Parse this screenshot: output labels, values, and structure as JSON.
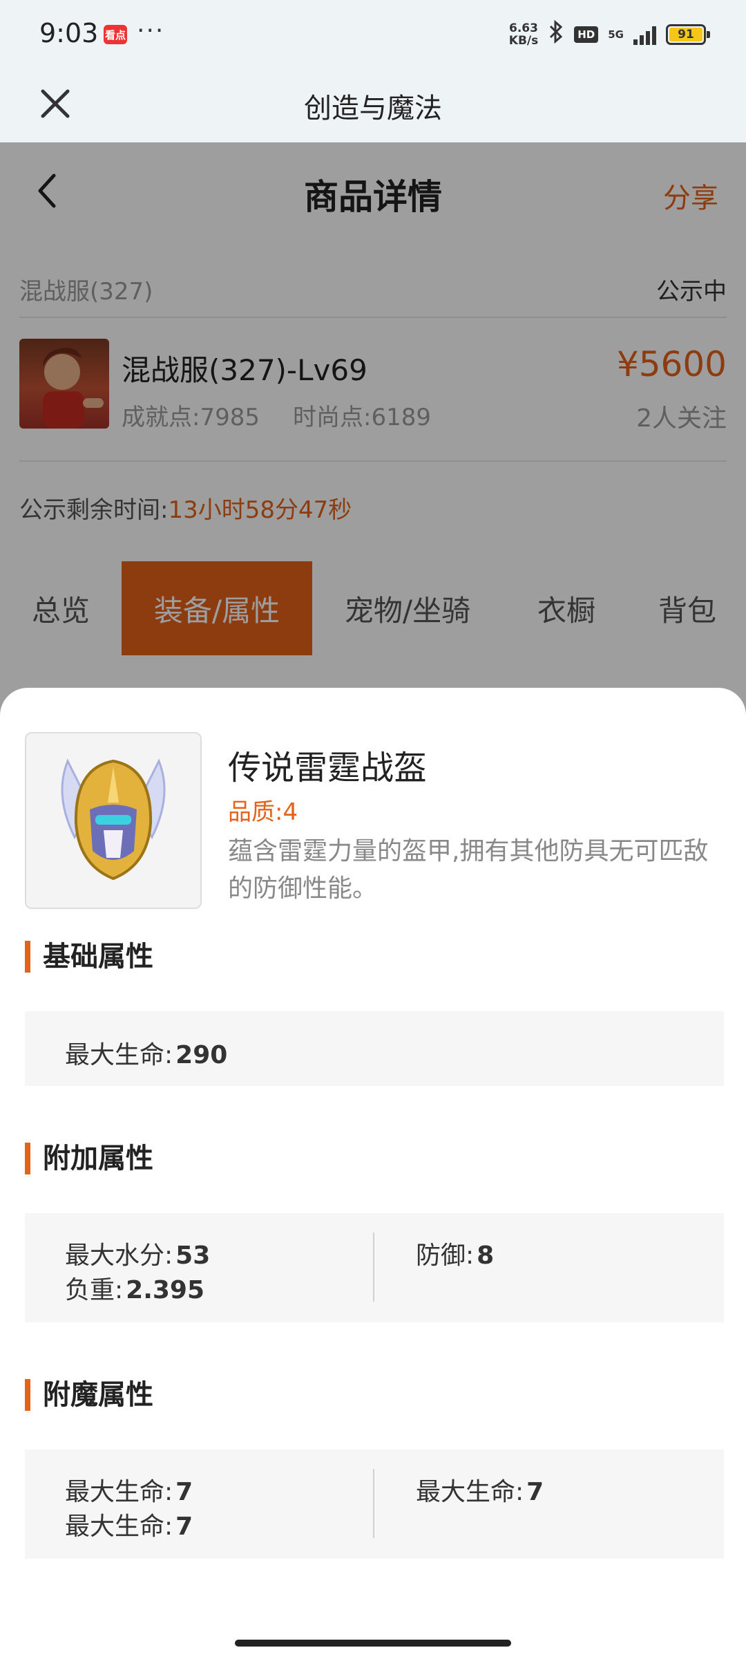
{
  "status": {
    "time": "9:03",
    "app_badge": "看点",
    "more": "···",
    "speed_top": "6.63",
    "speed_unit": "KB/s",
    "hd": "HD",
    "net": "5G",
    "battery": "91"
  },
  "browser": {
    "title": "创造与魔法"
  },
  "nav": {
    "title": "商品详情",
    "share": "分享"
  },
  "info": {
    "server_name": "混战服(327)",
    "status": "公示中"
  },
  "product": {
    "title": "混战服(327)-Lv69",
    "achievement": "成就点:7985",
    "fashion": "时尚点:6189",
    "price": "¥5600",
    "followers": "2人关注"
  },
  "remaining": {
    "label": "公示剩余时间:",
    "value": "13小时58分47秒"
  },
  "tabs": [
    {
      "label": "总览"
    },
    {
      "label": "装备/属性"
    },
    {
      "label": "宠物/坐骑"
    },
    {
      "label": "衣橱"
    },
    {
      "label": "背包"
    }
  ],
  "item": {
    "name": "传说雷霆战盔",
    "quality": "品质:4",
    "description": "蕴含雷霆力量的盔甲,拥有其他防具无可匹敌的防御性能。"
  },
  "sections": {
    "basic": {
      "title": "基础属性",
      "attrs": [
        {
          "label": "最大生命:",
          "value": "290"
        }
      ]
    },
    "extra": {
      "title": "附加属性",
      "attrs": [
        {
          "label": "最大水分:",
          "value": "53"
        },
        {
          "label": "负重:",
          "value": "2.395"
        },
        {
          "label": "防御:",
          "value": "8"
        }
      ]
    },
    "enchant": {
      "title": "附魔属性",
      "attrs": [
        {
          "label": "最大生命:",
          "value": "7"
        },
        {
          "label": "最大生命:",
          "value": "7"
        },
        {
          "label": "最大生命:",
          "value": "7"
        }
      ]
    }
  },
  "colors": {
    "accent": "#e4621a",
    "header_bg": "#eef3f6",
    "panel_bg": "#f6f6f6"
  }
}
